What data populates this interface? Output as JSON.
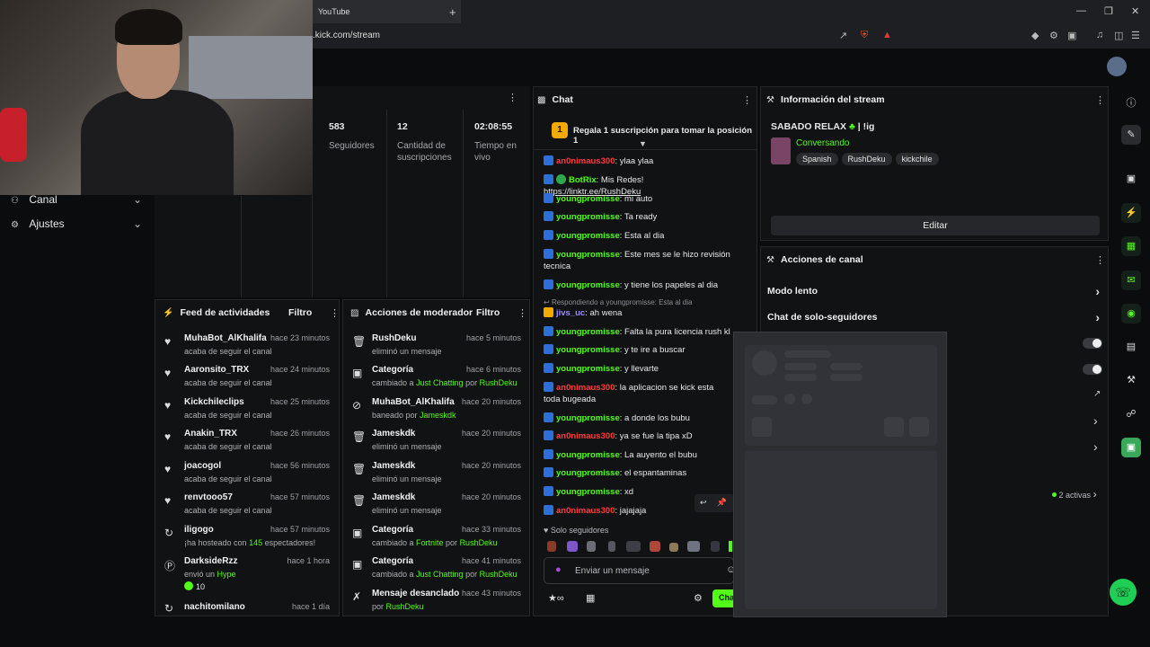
{
  "browser": {
    "tab_title": "YouTube",
    "url": ".kick.com/stream"
  },
  "leftnav": {
    "items": [
      {
        "label": "Canal"
      },
      {
        "label": "Ajustes"
      }
    ]
  },
  "stats": {
    "followers_value": "583",
    "followers_label": "Seguidores",
    "subs_value": "12",
    "subs_label": "Cantidad de suscripciones",
    "live_value": "02:08:55",
    "live_label": "Tiempo en vivo"
  },
  "feed": {
    "title": "Feed de actividades",
    "filter": "Filtro",
    "rows": [
      {
        "user": "MuhaBot_AlKhalifa",
        "sub": "acaba de seguir el canal",
        "time": "hace 23 minutos"
      },
      {
        "user": "Aaronsito_TRX",
        "sub": "acaba de seguir el canal",
        "time": "hace 24 minutos"
      },
      {
        "user": "Kickchileclips",
        "sub": "acaba de seguir el canal",
        "time": "hace 25 minutos"
      },
      {
        "user": "Anakin_TRX",
        "sub": "acaba de seguir el canal",
        "time": "hace 26 minutos"
      },
      {
        "user": "joacogol",
        "sub": "acaba de seguir el canal",
        "time": "hace 56 minutos"
      },
      {
        "user": "renvtooo57",
        "sub": "acaba de seguir el canal",
        "time": "hace 57 minutos"
      },
      {
        "user": "iligogo",
        "sub_a": "¡ha hosteado con ",
        "sub_b": "145",
        "sub_c": " espectadores!",
        "time": "hace 57 minutos"
      },
      {
        "user": "DarksideRzz",
        "sub_a": "envió un ",
        "sub_b": "Hype",
        "time": "hace 1 hora",
        "amount": "10"
      },
      {
        "user": "nachitomilano",
        "time": "hace 1 día"
      }
    ]
  },
  "mod": {
    "title": "Acciones de moderador",
    "filter": "Filtro",
    "rows": [
      {
        "user": "RushDeku",
        "sub": "eliminó un mensaje",
        "time": "hace 5 minutos"
      },
      {
        "user": "Categoría",
        "sub_a": "cambiado a ",
        "sub_b": "Just Chatting",
        "sub_c": " por ",
        "sub_d": "RushDeku",
        "time": "hace 6 minutos"
      },
      {
        "user": "MuhaBot_AlKhalifa",
        "sub_a": "baneado por ",
        "sub_b": "Jameskdk",
        "time": "hace 20 minutos"
      },
      {
        "user": "Jameskdk",
        "sub": "eliminó un mensaje",
        "time": "hace 20 minutos"
      },
      {
        "user": "Jameskdk",
        "sub": "eliminó un mensaje",
        "time": "hace 20 minutos"
      },
      {
        "user": "Jameskdk",
        "sub": "eliminó un mensaje",
        "time": "hace 20 minutos"
      },
      {
        "user": "Categoría",
        "sub_a": "cambiado a ",
        "sub_b": "Fortnite",
        "sub_c": " por ",
        "sub_d": "RushDeku",
        "time": "hace 33 minutos"
      },
      {
        "user": "Categoría",
        "sub_a": "cambiado a ",
        "sub_b": "Just Chatting",
        "sub_c": " por ",
        "sub_d": "RushDeku",
        "time": "hace 41 minutos"
      },
      {
        "user": "Mensaje desanclado",
        "sub_a": "por ",
        "sub_b": "RushDeku",
        "time": "hace 43 minutos"
      }
    ]
  },
  "chat": {
    "title": "Chat",
    "gift_banner": "Regala 1 suscripción para tomar la posición 1",
    "gift_pos": "1",
    "lines": [
      {
        "user": "an0nimaus300",
        "text": ": ylaa ylaa"
      },
      {
        "user": "BotRix",
        "text": ": Mis Redes! ",
        "link": "https://linktr.ee/RushDeku"
      },
      {
        "user": "youngpromisse",
        "text": ": mi auto"
      },
      {
        "user": "youngpromisse",
        "text": ": Ta ready"
      },
      {
        "user": "youngpromisse",
        "text": ": Esta al dia"
      },
      {
        "user": "youngpromisse",
        "text": ": Este mes se le hizo revisión tecnica"
      },
      {
        "user": "youngpromisse",
        "text": ": y tiene los papeles al dia"
      },
      {
        "reply": "Respondiendo a youngpromisse: Esta al dia"
      },
      {
        "user": "jivs_uc",
        "text": ": ah wena"
      },
      {
        "user": "youngpromisse",
        "text": ": Falta la pura licencia rush kl"
      },
      {
        "user": "youngpromisse",
        "text": ": y te ire a buscar"
      },
      {
        "user": "youngpromisse",
        "text": ": y llevarte"
      },
      {
        "user": "an0nimaus300",
        "text": ": la aplicacion se kick esta toda bugeada"
      },
      {
        "user": "youngpromisse",
        "text": ": a donde los bubu"
      },
      {
        "user": "an0nimaus300",
        "text": ": ya se fue la tipa xD"
      },
      {
        "user": "youngpromisse",
        "text": ": La auyento el bubu"
      },
      {
        "user": "youngpromisse",
        "text": ": el espantaminas"
      },
      {
        "user": "youngpromisse",
        "text": ": xd"
      },
      {
        "user": "an0nimaus300",
        "text": ": jajajaja"
      }
    ],
    "followers_only": "Solo seguidores",
    "input_placeholder": "Enviar un mensaje",
    "send_label": "Cha"
  },
  "info": {
    "title": "Información del stream",
    "stream_title": "SABADO RELAX",
    "stream_title_suffix": "| !ig",
    "category": "Conversando",
    "tags": [
      "Spanish",
      "RushDeku",
      "kickchile"
    ],
    "edit": "Editar"
  },
  "actions": {
    "title": "Acciones de canal",
    "slow_mode": "Modo lento",
    "followers_chat": "Chat de solo-seguidores",
    "active": "2 activas"
  },
  "colors": {
    "accent": "#53fc18",
    "badge_blue": "#2d6fd8",
    "user_red": "#ff3b3b",
    "gift_gold": "#f2a900"
  }
}
